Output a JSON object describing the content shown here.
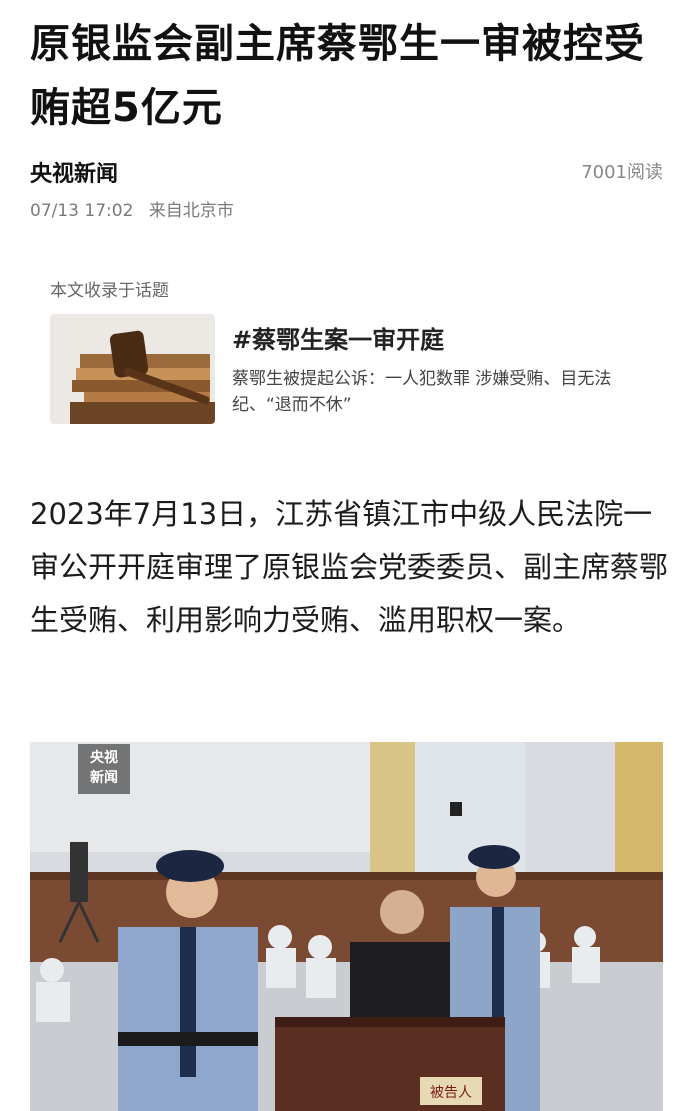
{
  "article": {
    "title": "原银监会副主席蔡鄂生一审被控受贿超5亿元",
    "source": "央视新闻",
    "reads": "7001阅读",
    "date": "07/13 17:02",
    "location": "来自北京市"
  },
  "topic": {
    "label": "本文收录于话题",
    "title": "#蔡鄂生案一审开庭",
    "description": "蔡鄂生被提起公诉：一人犯数罪 涉嫌受贿、目无法纪、“退而不休”"
  },
  "body": {
    "paragraph": "2023年7月13日，江苏省镇江市中级人民法院一审公开开庭审理了原银监会党委委员、副主席蔡鄂生受贿、利用影响力受贿、滥用职权一案。"
  },
  "photo": {
    "logo_line1": "央视",
    "logo_line2": "新闻",
    "sign_text": "被告人"
  }
}
